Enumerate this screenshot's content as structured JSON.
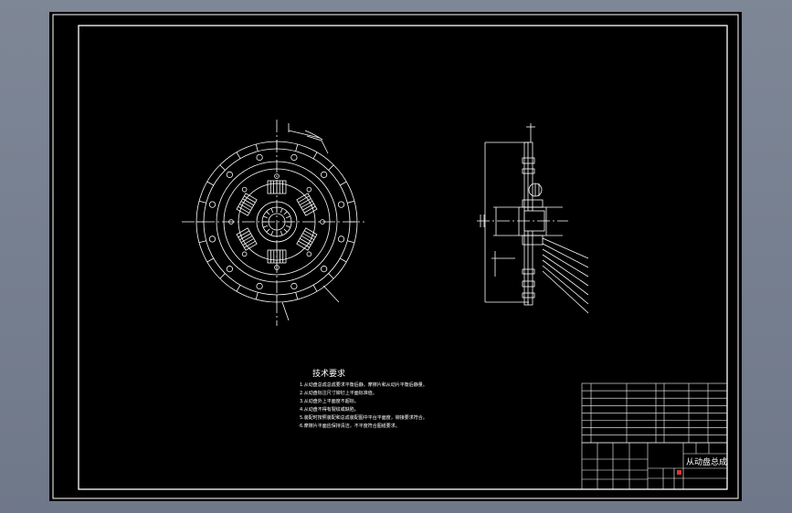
{
  "drawing": {
    "tech_requirements": {
      "title": "技术要求",
      "lines": [
        "1.从动盘总成总成要求平衡后静，摩擦片和从动片平衡后静量。",
        "2.从动盘标注尺寸铆钉上平面标准值。",
        "3.从动盘外上平面度不超标。",
        "4.从动盘不得有裂纹或缺陷。",
        "5.装配时按照装配和总成装配图中平台平面度，铆接要求符合。",
        "6.摩擦片平面应保持清洁，不平度符合图纸要求。"
      ]
    },
    "title_block": {
      "drawing_title": "从动盘总成"
    }
  }
}
